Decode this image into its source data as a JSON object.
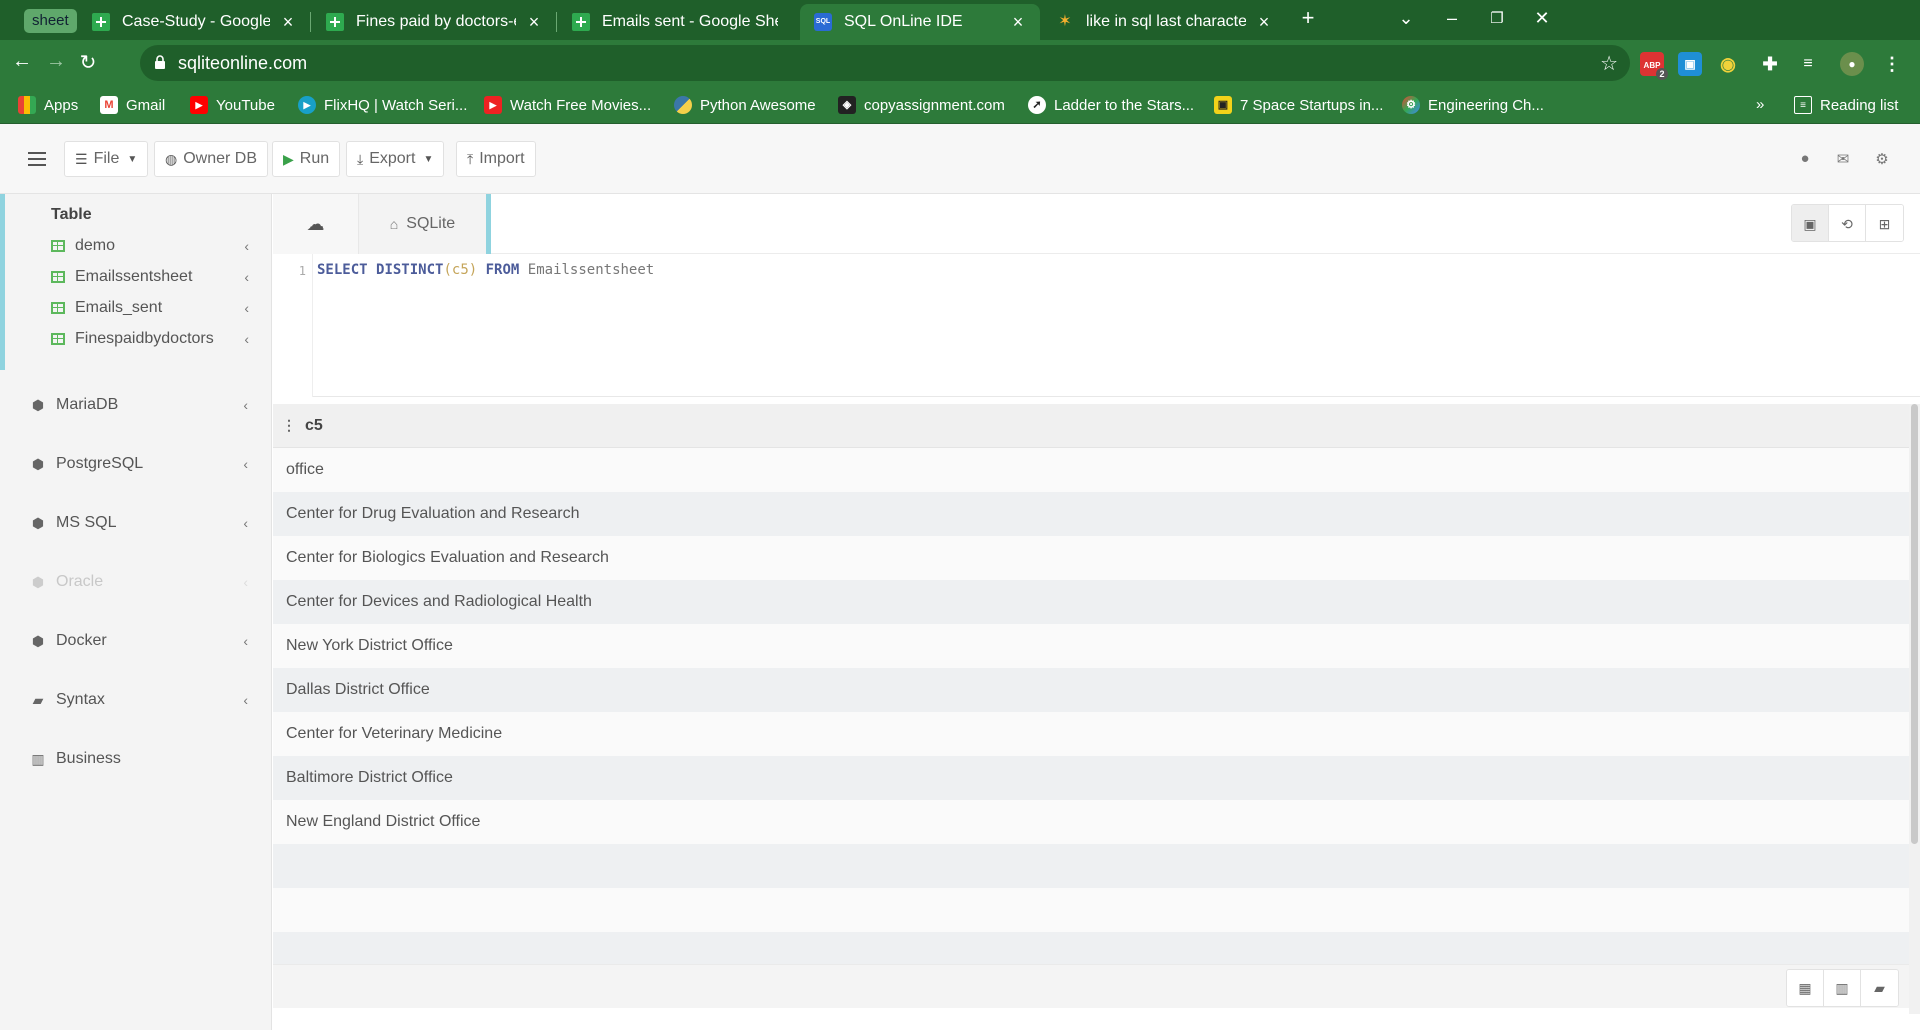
{
  "browser": {
    "tab_group_label": "sheet",
    "tabs": [
      {
        "title": "Case-Study - Google Sheets",
        "favicon": "sheets-icon"
      },
      {
        "title": "Fines paid by doctors-edit - Goo",
        "favicon": "sheets-icon"
      },
      {
        "title": "Emails sent - Google Sheets",
        "favicon": "sheets-icon"
      },
      {
        "title": "SQL OnLine IDE",
        "favicon": "sql-icon",
        "favicon_text": "SQL"
      },
      {
        "title": "like in sql last character Code Exa",
        "favicon": "grepper-icon"
      }
    ],
    "url": "sqliteonline.com",
    "bookmarks": [
      {
        "label": "Apps"
      },
      {
        "label": "Gmail"
      },
      {
        "label": "YouTube"
      },
      {
        "label": "FlixHQ | Watch Seri..."
      },
      {
        "label": "Watch Free Movies..."
      },
      {
        "label": "Python Awesome"
      },
      {
        "label": "copyassignment.com"
      },
      {
        "label": "Ladder to the Stars..."
      },
      {
        "label": "7 Space Startups in..."
      },
      {
        "label": "Engineering Ch..."
      }
    ],
    "reading_list": "Reading list",
    "ext_abp": "ABP",
    "ext_badge": "2",
    "overflow": "»"
  },
  "header": {
    "file": "File",
    "owner_db": "Owner DB",
    "run": "Run",
    "export": "Export",
    "import": "Import"
  },
  "sidebar": {
    "table_header": "Table",
    "tables": [
      "demo",
      "Emailssentsheet",
      "Emails_sent",
      "Finespaidbydoctors"
    ],
    "databases": [
      {
        "label": "MariaDB",
        "disabled": false
      },
      {
        "label": "PostgreSQL",
        "disabled": false
      },
      {
        "label": "MS SQL",
        "disabled": false
      },
      {
        "label": "Oracle",
        "disabled": true
      },
      {
        "label": "Docker",
        "disabled": false
      },
      {
        "label": "Syntax",
        "disabled": false
      },
      {
        "label": "Business",
        "disabled": false
      }
    ]
  },
  "editor": {
    "tab_label": "SQLite",
    "line_number": "1",
    "tokens": {
      "kw_select": "SELECT",
      "kw_distinct": "DISTINCT",
      "paren_open": "(",
      "column": "c5",
      "paren_close": ")",
      "kw_from": "FROM",
      "table": "Emailssentsheet"
    }
  },
  "results": {
    "column": "c5",
    "rows": [
      "office",
      "Center for Drug Evaluation and Research",
      "Center for Biologics Evaluation and Research",
      "Center for Devices and Radiological Health",
      "New York District Office",
      "Dallas District Office",
      "Center for Veterinary Medicine",
      "Baltimore District Office",
      "New England District Office",
      "",
      "",
      ""
    ]
  }
}
